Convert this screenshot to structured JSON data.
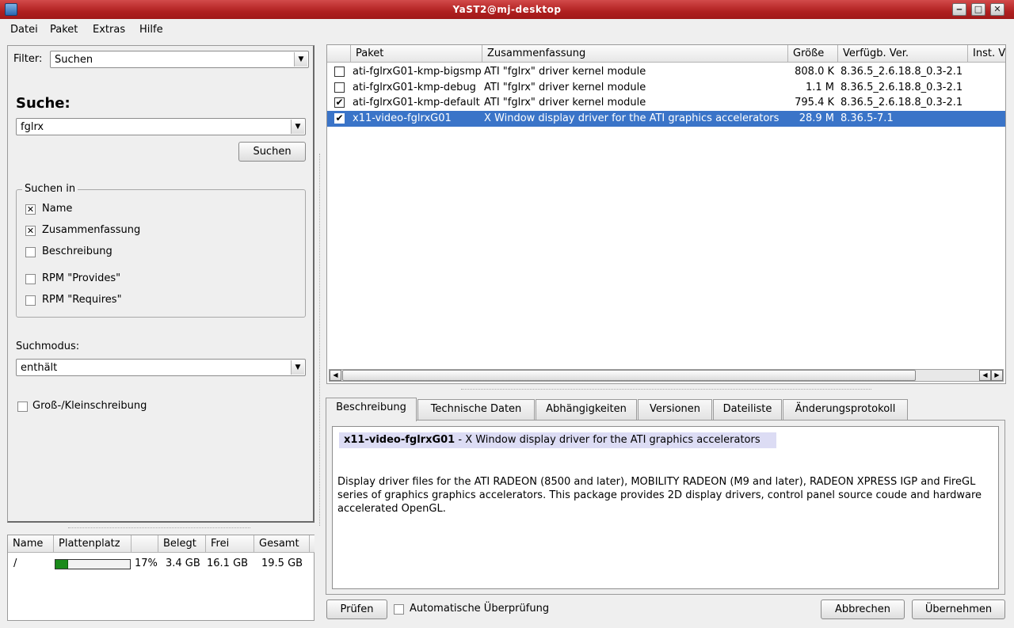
{
  "window": {
    "title": "YaST2@mj-desktop"
  },
  "menu": {
    "datei": "Datei",
    "paket": "Paket",
    "extras": "Extras",
    "hilfe": "Hilfe"
  },
  "search": {
    "filter_label": "Filter:",
    "filter_value": "Suchen",
    "heading": "Suche:",
    "query": "fglrx",
    "search_button": "Suchen",
    "search_in_label": "Suchen in",
    "options": [
      {
        "label": "Name",
        "checked": true
      },
      {
        "label": "Zusammenfassung",
        "checked": true
      },
      {
        "label": "Beschreibung",
        "checked": false
      },
      {
        "label": "RPM \"Provides\"",
        "checked": false
      },
      {
        "label": "RPM \"Requires\"",
        "checked": false
      }
    ],
    "mode_label": "Suchmodus:",
    "mode_value": "enthält",
    "case_label": "Groß-/Kleinschreibung"
  },
  "disk": {
    "headers": [
      "Name",
      "Plattenplatz",
      "",
      "Belegt",
      "Frei",
      "Gesamt"
    ],
    "rows": [
      {
        "name": "/",
        "usage_fraction": 0.17,
        "percent": "17%",
        "used": "3.4 GB",
        "free": "16.1 GB",
        "total": "19.5 GB"
      }
    ]
  },
  "packages": {
    "headers": [
      "Paket",
      "Zusammenfassung",
      "Größe",
      "Verfügb. Ver.",
      "Inst. V"
    ],
    "rows": [
      {
        "name": "ati-fglrxG01-kmp-bigsmp",
        "summary": "ATI \"fglrx\" driver kernel module",
        "size": "808.0 K",
        "version": "8.36.5_2.6.18.8_0.3-2.1",
        "checked": false,
        "selected": false
      },
      {
        "name": "ati-fglrxG01-kmp-debug",
        "summary": "ATI \"fglrx\" driver kernel module",
        "size": "1.1 M",
        "version": "8.36.5_2.6.18.8_0.3-2.1",
        "checked": false,
        "selected": false
      },
      {
        "name": "ati-fglrxG01-kmp-default",
        "summary": "ATI \"fglrx\" driver kernel module",
        "size": "795.4 K",
        "version": "8.36.5_2.6.18.8_0.3-2.1",
        "checked": true,
        "selected": false
      },
      {
        "name": "x11-video-fglrxG01",
        "summary": "X Window display driver for the ATI graphics accelerators",
        "size": "28.9 M",
        "version": "8.36.5-7.1",
        "checked": true,
        "selected": true
      }
    ]
  },
  "tabs": [
    "Beschreibung",
    "Technische Daten",
    "Abhängigkeiten",
    "Versionen",
    "Dateiliste",
    "Änderungsprotokoll"
  ],
  "details": {
    "pkg_name": "x11-video-fglrxG01",
    "pkg_summary": " - X Window display driver for the ATI graphics accelerators",
    "description": "Display driver files for the ATI RADEON (8500 and later), MOBILITY RADEON (M9 and later), RADEON XPRESS IGP and FireGL series of graphics graphics accelerators. This package provides 2D display drivers, control panel source coude and hardware accelerated OpenGL."
  },
  "bottom": {
    "check_button": "Prüfen",
    "auto_check_label": "Automatische Überprüfung",
    "cancel_button": "Abbrechen",
    "accept_button": "Übernehmen"
  }
}
